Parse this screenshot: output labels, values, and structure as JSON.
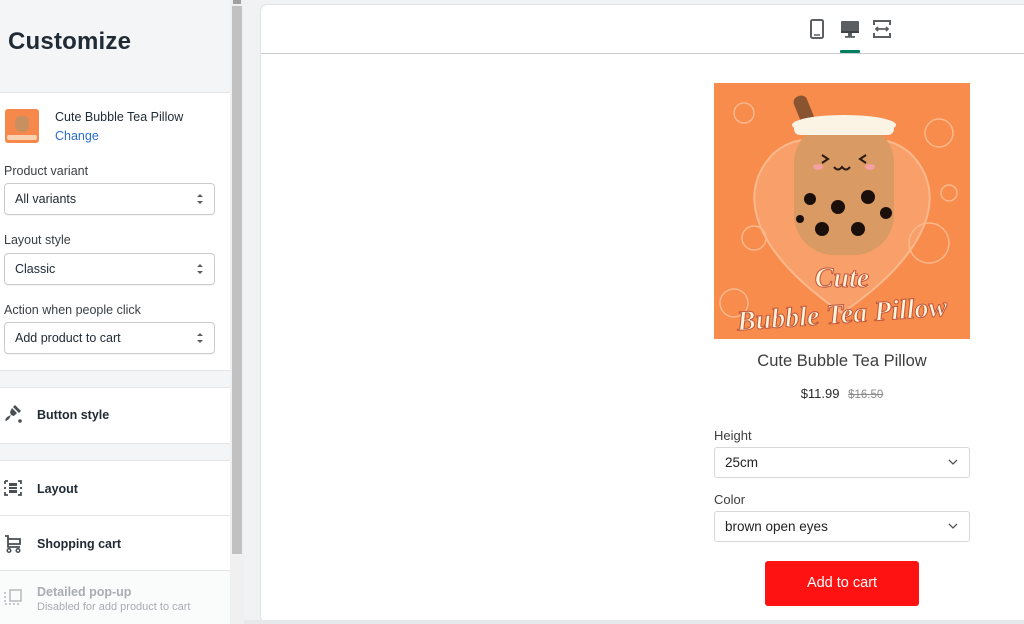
{
  "sidebar": {
    "title": "Customize",
    "product": {
      "name": "Cute Bubble Tea Pillow",
      "change_label": "Change",
      "thumbnail_icon": "product-thumbnail"
    },
    "fields": [
      {
        "label": "Product variant",
        "value": "All variants"
      },
      {
        "label": "Layout style",
        "value": "Classic"
      },
      {
        "label": "Action when people click",
        "value": "Add product to cart"
      }
    ],
    "menu": [
      {
        "label": "Button style",
        "icon": "paint-brush-icon",
        "disabled": false
      },
      {
        "label": "Layout",
        "icon": "layout-icon",
        "disabled": false
      },
      {
        "label": "Shopping cart",
        "icon": "cart-icon",
        "disabled": false
      },
      {
        "label": "Detailed pop-up",
        "sublabel": "Disabled for add product to cart",
        "icon": "popup-icon",
        "disabled": true
      }
    ]
  },
  "preview": {
    "viewport_buttons": [
      {
        "name": "mobile",
        "icon": "mobile-icon",
        "active": false
      },
      {
        "name": "desktop",
        "icon": "desktop-icon",
        "active": true
      },
      {
        "name": "full-width",
        "icon": "expand-horizontal-icon",
        "active": false
      }
    ],
    "product_card": {
      "image_caption_line1": "Cute",
      "image_caption_line2": "Bubble Tea Pillow",
      "title": "Cute Bubble Tea Pillow",
      "price": "$11.99",
      "compare_at_price": "$16.50",
      "options": [
        {
          "label": "Height",
          "value": "25cm"
        },
        {
          "label": "Color",
          "value": "brown open eyes"
        }
      ],
      "add_to_cart_label": "Add to cart"
    }
  },
  "colors": {
    "accent_link": "#2c6ecb",
    "active_tab_indicator": "#008060",
    "add_to_cart_bg": "#ff1212",
    "image_bg": "#f78c4c"
  }
}
